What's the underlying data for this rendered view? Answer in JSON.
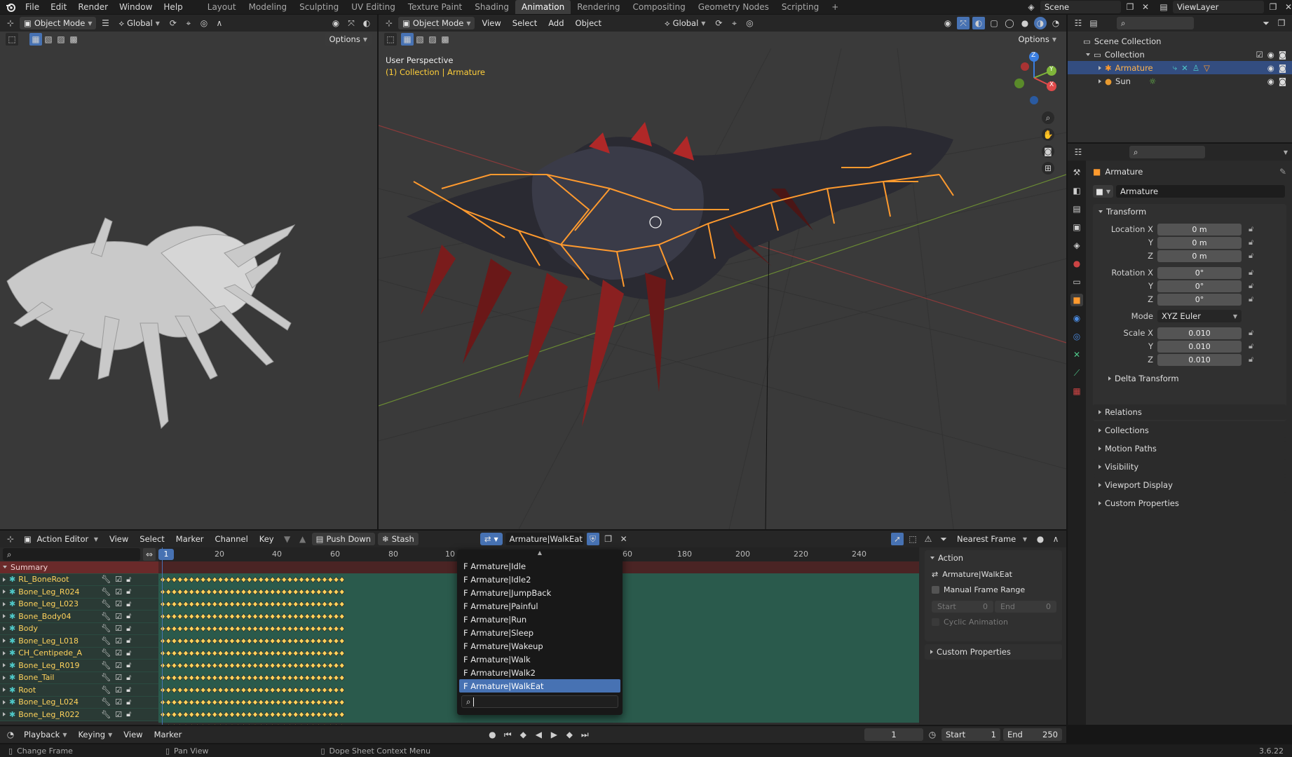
{
  "topbar": {
    "menus": [
      "File",
      "Edit",
      "Render",
      "Window",
      "Help"
    ],
    "workspaces": [
      "Layout",
      "Modeling",
      "Sculpting",
      "UV Editing",
      "Texture Paint",
      "Shading",
      "Animation",
      "Rendering",
      "Compositing",
      "Geometry Nodes",
      "Scripting"
    ],
    "active_workspace": "Animation",
    "add_tab": "+",
    "scene": "Scene",
    "view_layer": "ViewLayer"
  },
  "left_view": {
    "mode": "Object Mode",
    "orientation": "Global",
    "options": "Options"
  },
  "main_view": {
    "mode": "Object Mode",
    "menus": [
      "View",
      "Select",
      "Add",
      "Object"
    ],
    "orientation": "Global",
    "options": "Options",
    "overlay_title": "User Perspective",
    "overlay_subtitle": "(1) Collection | Armature",
    "gizmo": {
      "x": "X",
      "y": "Y",
      "z": "Z"
    }
  },
  "outliner": {
    "items": [
      {
        "label": "Scene Collection",
        "indent": 0
      },
      {
        "label": "Collection",
        "indent": 1
      },
      {
        "label": "Armature",
        "indent": 2
      },
      {
        "label": "Sun",
        "indent": 2
      }
    ]
  },
  "properties": {
    "object_name": "Armature",
    "data_name": "Armature",
    "transform_label": "Transform",
    "location_label": "Location X",
    "rotation_label": "Rotation X",
    "scale_label": "Scale X",
    "axis_y": "Y",
    "axis_z": "Z",
    "location": [
      "0 m",
      "0 m",
      "0 m"
    ],
    "rotation": [
      "0°",
      "0°",
      "0°"
    ],
    "mode_label": "Mode",
    "mode_value": "XYZ Euler",
    "scale": [
      "0.010",
      "0.010",
      "0.010"
    ],
    "delta_transform": "Delta Transform",
    "panels": [
      "Relations",
      "Collections",
      "Motion Paths",
      "Visibility",
      "Viewport Display",
      "Custom Properties"
    ]
  },
  "action_editor": {
    "mode": "Action Editor",
    "menus": [
      "View",
      "Select",
      "Marker",
      "Channel",
      "Key"
    ],
    "push_down": "Push Down",
    "stash": "Stash",
    "action_name": "Armature|WalkEat",
    "snap": "Nearest Frame",
    "ruler": [
      "1",
      "20",
      "40",
      "60",
      "80",
      "10",
      "60",
      "180",
      "200",
      "220",
      "240"
    ],
    "summary": "Summary",
    "channels": [
      "RL_BoneRoot",
      "Bone_Leg_R024",
      "Bone_Leg_L023",
      "Bone_Body04",
      "Body",
      "Bone_Leg_L018",
      "CH_Centipede_A",
      "Bone_Leg_R019",
      "Bone_Tail",
      "Root",
      "Bone_Leg_L024",
      "Bone_Leg_R022"
    ]
  },
  "dropdown": {
    "items": [
      "F Armature|Idle",
      "F Armature|Idle2",
      "F Armature|JumpBack",
      "F Armature|Painful",
      "F Armature|Run",
      "F Armature|Sleep",
      "F Armature|Wakeup",
      "F Armature|Walk",
      "F Armature|Walk2",
      "F Armature|WalkEat"
    ],
    "selected": 9
  },
  "action_panel": {
    "title": "Action",
    "action_name": "Armature|WalkEat",
    "manual_frame_range": "Manual Frame Range",
    "start_label": "Start",
    "start_value": "0",
    "end_label": "End",
    "end_value": "0",
    "cyclic": "Cyclic Animation",
    "custom_properties": "Custom Properties"
  },
  "timeline": {
    "menus": [
      "Playback",
      "Keying",
      "View",
      "Marker"
    ],
    "current_frame": "1",
    "start_label": "Start",
    "start_value": "1",
    "end_label": "End",
    "end_value": "250"
  },
  "statusbar": {
    "items": [
      "Change Frame",
      "Pan View",
      "Dope Sheet Context Menu"
    ],
    "version": "3.6.22"
  },
  "colors": {
    "accent": "#4772b3",
    "bones": "#ff9a2e",
    "channel_text": "#ffd35c"
  }
}
